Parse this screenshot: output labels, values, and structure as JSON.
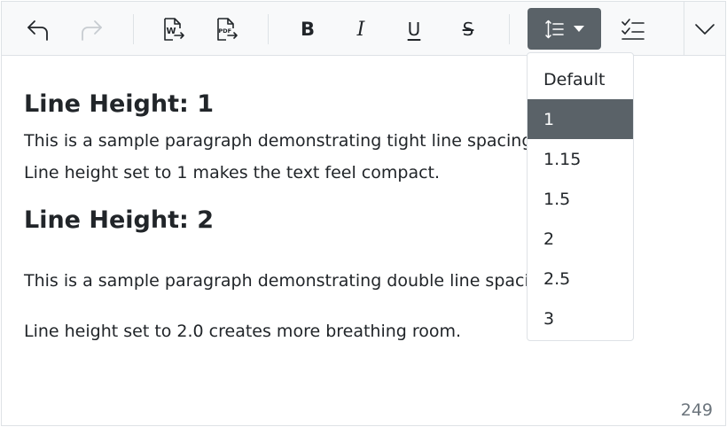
{
  "toolbar": {
    "buttons": [
      {
        "name": "undo",
        "icon": "undo-icon"
      },
      {
        "name": "redo",
        "icon": "redo-icon"
      },
      {
        "name": "export-word",
        "icon": "word-export-icon"
      },
      {
        "name": "export-pdf",
        "icon": "pdf-export-icon"
      },
      {
        "name": "bold",
        "icon": "bold-icon"
      },
      {
        "name": "italic",
        "icon": "italic-icon"
      },
      {
        "name": "underline",
        "icon": "underline-icon"
      },
      {
        "name": "strikethrough",
        "icon": "strikethrough-icon"
      },
      {
        "name": "line-height",
        "icon": "line-height-icon"
      },
      {
        "name": "checklist",
        "icon": "checklist-icon"
      },
      {
        "name": "more",
        "icon": "chevron-down-icon"
      }
    ],
    "word_icon_letter": "W",
    "pdf_icon_text": "PDF",
    "bold_label": "B",
    "italic_label": "I",
    "underline_label": "U",
    "strike_label": "S"
  },
  "content": {
    "heading1": "Line Height: 1",
    "para1_line1": "This is a sample paragraph demonstrating tight line spacing.",
    "para1_line2": "Line height set to 1 makes the text feel compact.",
    "heading2": "Line Height: 2",
    "para2_line1": "This is a sample paragraph demonstrating double line spacing.",
    "para2_line2": "Line height set to 2.0 creates more breathing room."
  },
  "status": {
    "char_count": "249"
  },
  "line_height_dropdown": {
    "selected": "1",
    "options": [
      "Default",
      "1",
      "1.15",
      "1.5",
      "2",
      "2.5",
      "3"
    ]
  },
  "colors": {
    "toolbar_bg": "#f8f9fa",
    "active_bg": "#5a6268",
    "border": "#dee2e6",
    "text": "#212529",
    "muted": "#6c757d",
    "disabled_icon": "#c7ccd1"
  }
}
